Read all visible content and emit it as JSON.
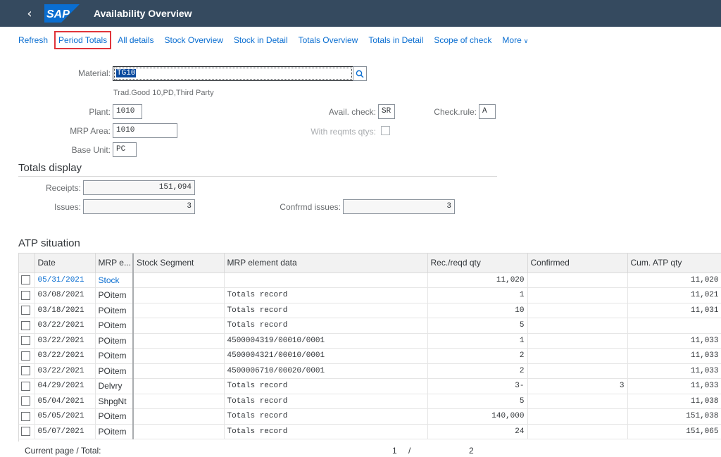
{
  "shell": {
    "back_icon": "chevron-left-icon",
    "logo_text": "SAP",
    "title": "Availability Overview",
    "brand_color": "#0a6ed1",
    "bar_color": "#354a5f"
  },
  "toolbar": {
    "items": [
      "Refresh",
      "Period Totals",
      "All details",
      "Stock Overview",
      "Stock in Detail",
      "Totals Overview",
      "Totals in Detail",
      "Scope of check"
    ],
    "more_label": "More",
    "highlighted": "Period Totals",
    "highlight_color": "#e0343a"
  },
  "form": {
    "material_label": "Material:",
    "material_value": "TG10",
    "material_desc": "Trad.Good 10,PD,Third Party",
    "plant_label": "Plant:",
    "plant_value": "1010",
    "avail_check_label": "Avail. check:",
    "avail_check_value": "SR",
    "check_rule_label": "Check.rule:",
    "check_rule_value": "A",
    "mrp_area_label": "MRP Area:",
    "mrp_area_value": "1010",
    "with_reqmts_label": "With reqmts qtys:",
    "with_reqmts_checked": false,
    "base_unit_label": "Base Unit:",
    "base_unit_value": "PC"
  },
  "totals": {
    "title": "Totals display",
    "receipts_label": "Receipts:",
    "receipts_value": "151,094",
    "issues_label": "Issues:",
    "issues_value": "3",
    "confirmed_label": "Confrmd issues:",
    "confirmed_value": "3"
  },
  "atp": {
    "title": "ATP situation",
    "columns": [
      "",
      "Date",
      "MRP e...",
      "Stock Segment",
      "MRP element data",
      "Rec./reqd qty",
      "Confirmed",
      "Cum. ATP qty"
    ],
    "rows": [
      {
        "date": "05/31/2021",
        "mrp": "Stock",
        "segment": "",
        "element": "",
        "qty": "11,020",
        "confirmed": "",
        "cum": "11,020",
        "link": true
      },
      {
        "date": "03/08/2021",
        "mrp": "POitem",
        "segment": "",
        "element": "Totals record",
        "qty": "1",
        "confirmed": "",
        "cum": "11,021"
      },
      {
        "date": "03/18/2021",
        "mrp": "POitem",
        "segment": "",
        "element": "Totals record",
        "qty": "10",
        "confirmed": "",
        "cum": "11,031"
      },
      {
        "date": "03/22/2021",
        "mrp": "POitem",
        "segment": "",
        "element": "Totals record",
        "qty": "5",
        "confirmed": "",
        "cum": ""
      },
      {
        "date": "03/22/2021",
        "mrp": "POitem",
        "segment": "",
        "element": "4500004319/00010/0001",
        "qty": "1",
        "confirmed": "",
        "cum": "11,033"
      },
      {
        "date": "03/22/2021",
        "mrp": "POitem",
        "segment": "",
        "element": "4500004321/00010/0001",
        "qty": "2",
        "confirmed": "",
        "cum": "11,033"
      },
      {
        "date": "03/22/2021",
        "mrp": "POitem",
        "segment": "",
        "element": "4500006710/00020/0001",
        "qty": "2",
        "confirmed": "",
        "cum": "11,033"
      },
      {
        "date": "04/29/2021",
        "mrp": "Delvry",
        "segment": "",
        "element": "Totals record",
        "qty": "3-",
        "confirmed": "3",
        "cum": "11,033"
      },
      {
        "date": "05/04/2021",
        "mrp": "ShpgNt",
        "segment": "",
        "element": "Totals record",
        "qty": "5",
        "confirmed": "",
        "cum": "11,038"
      },
      {
        "date": "05/05/2021",
        "mrp": "POitem",
        "segment": "",
        "element": "Totals record",
        "qty": "140,000",
        "confirmed": "",
        "cum": "151,038"
      },
      {
        "date": "05/07/2021",
        "mrp": "POitem",
        "segment": "",
        "element": "Totals record",
        "qty": "24",
        "confirmed": "",
        "cum": "151,065"
      }
    ]
  },
  "footer": {
    "page_label": "Current page / Total:",
    "current_page": "1",
    "separator": "/",
    "total_pages": "2"
  }
}
